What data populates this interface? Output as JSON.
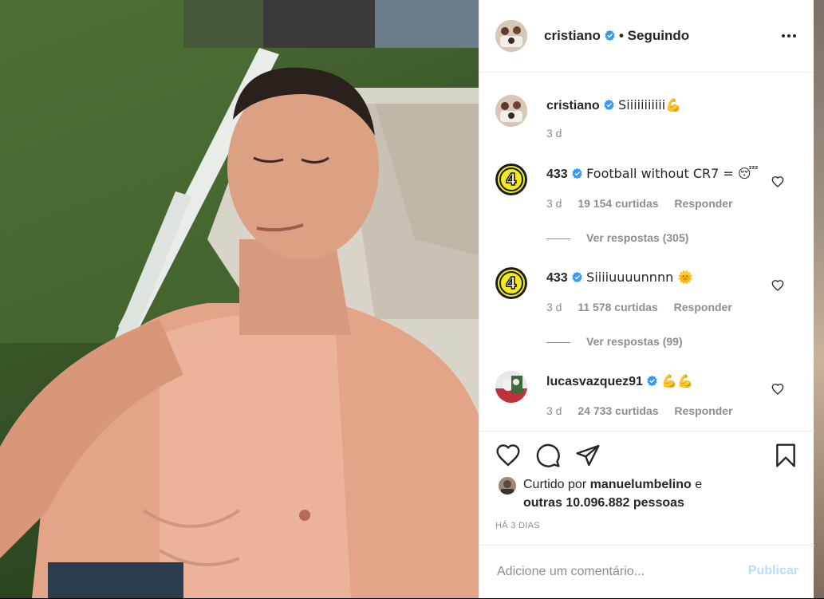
{
  "post": {
    "author": "cristiano",
    "follow_status": "• Seguindo",
    "photo_alt": "shirtless selfie on sun lounger"
  },
  "caption": {
    "user": "cristiano",
    "text": "Siiiiiiiiiii💪",
    "time": "3 d"
  },
  "comments": [
    {
      "user": "433",
      "text": "Football without CR7 = 😴",
      "time": "3 d",
      "likes": "19 154 curtidas",
      "reply_label": "Responder",
      "view_replies": "Ver respostas (305)"
    },
    {
      "user": "433",
      "text": "Siiiiuuuunnnn 🌞",
      "time": "3 d",
      "likes": "11 578 curtidas",
      "reply_label": "Responder",
      "view_replies": "Ver respostas (99)"
    },
    {
      "user": "lucasvazquez91",
      "text": "💪💪",
      "time": "3 d",
      "likes": "24 733 curtidas",
      "reply_label": "Responder"
    }
  ],
  "liked_by": {
    "prefix": "Curtido por",
    "user": "manuelumbelino",
    "connector": "e",
    "others": "outras 10.096.882 pessoas"
  },
  "timestamp": "HÁ 3 DIAS",
  "comment_box": {
    "placeholder": "Adicione um comentário...",
    "post_label": "Publicar"
  },
  "icons": {
    "like": "heart-icon",
    "comment": "comment-bubble-icon",
    "share": "paper-plane-icon",
    "save": "bookmark-icon",
    "more": "more-options-icon",
    "verified": "verified-badge-icon"
  },
  "colors": {
    "verified": "#3897f0",
    "muted_text": "#8e8e8e",
    "publish_disabled": "#b2dffc"
  }
}
